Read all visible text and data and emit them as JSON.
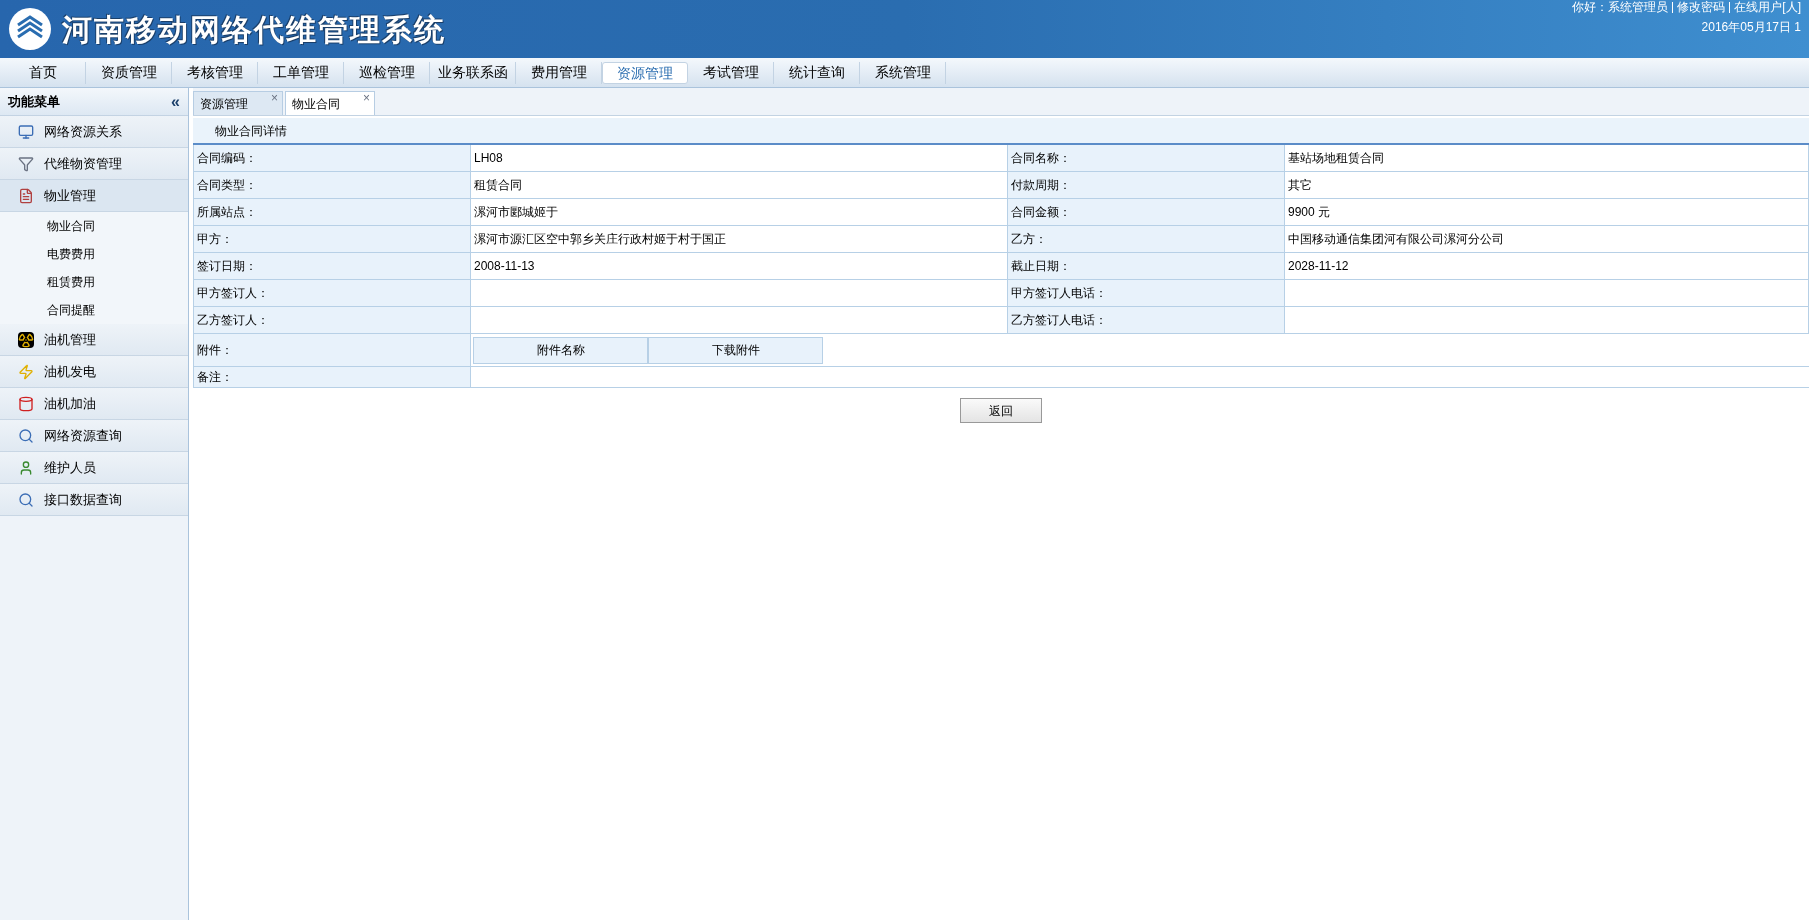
{
  "header": {
    "title": "河南移动网络代维管理系统",
    "user_links": [
      "你好：系统管理员",
      "修改密码",
      "在线用户[人]"
    ],
    "date": "2016年05月17日 1"
  },
  "nav": [
    {
      "label": "首页",
      "selected": false
    },
    {
      "label": "资质管理",
      "selected": false
    },
    {
      "label": "考核管理",
      "selected": false
    },
    {
      "label": "工单管理",
      "selected": false
    },
    {
      "label": "巡检管理",
      "selected": false
    },
    {
      "label": "业务联系函",
      "selected": false
    },
    {
      "label": "费用管理",
      "selected": false
    },
    {
      "label": "资源管理",
      "selected": true
    },
    {
      "label": "考试管理",
      "selected": false
    },
    {
      "label": "统计查询",
      "selected": false
    },
    {
      "label": "系统管理",
      "selected": false
    }
  ],
  "sidebar": {
    "title": "功能菜单",
    "collapse": "«",
    "items": [
      {
        "label": "网络资源关系",
        "expanded": false
      },
      {
        "label": "代维物资管理",
        "expanded": false
      },
      {
        "label": "物业管理",
        "expanded": true,
        "children": [
          {
            "label": "物业合同"
          },
          {
            "label": "电费费用"
          },
          {
            "label": "租赁费用"
          },
          {
            "label": "合同提醒"
          }
        ]
      },
      {
        "label": "油机管理",
        "expanded": false
      },
      {
        "label": "油机发电",
        "expanded": false
      },
      {
        "label": "油机加油",
        "expanded": false
      },
      {
        "label": "网络资源查询",
        "expanded": false
      },
      {
        "label": "维护人员",
        "expanded": false
      },
      {
        "label": "接口数据查询",
        "expanded": false
      }
    ]
  },
  "tabs": [
    {
      "label": "资源管理",
      "close": "×",
      "selected": false
    },
    {
      "label": "物业合同",
      "close": "×",
      "selected": true
    }
  ],
  "detail": {
    "title": "物业合同详情",
    "rows": [
      {
        "kind": "pair",
        "cells": [
          "合同编码：",
          "LH08",
          "合同名称：",
          "基站场地租赁合同"
        ]
      },
      {
        "kind": "pair",
        "cells": [
          "合同类型：",
          "租赁合同",
          "付款周期：",
          "其它"
        ]
      },
      {
        "kind": "pair",
        "cells": [
          "所属站点：",
          "漯河市郾城姬于",
          "合同金额：",
          "9900 元"
        ]
      },
      {
        "kind": "pair",
        "cells": [
          "甲方：",
          "漯河市源汇区空中郭乡关庄行政村姬于村于国正",
          "乙方：",
          "中国移动通信集团河有限公司漯河分公司"
        ]
      },
      {
        "kind": "pair",
        "cells": [
          "签订日期：",
          "2008-11-13",
          "截止日期：",
          "2028-11-12"
        ]
      },
      {
        "kind": "pair",
        "cells": [
          "甲方签订人：",
          "",
          "甲方签订人电话：",
          ""
        ]
      },
      {
        "kind": "pair",
        "cells": [
          "乙方签订人：",
          "",
          "乙方签订人电话：",
          ""
        ]
      },
      {
        "kind": "attachments",
        "label": "附件：",
        "columns": [
          "附件名称",
          "下载附件"
        ]
      },
      {
        "kind": "wide",
        "label": "备注："
      }
    ],
    "button": "返回"
  }
}
